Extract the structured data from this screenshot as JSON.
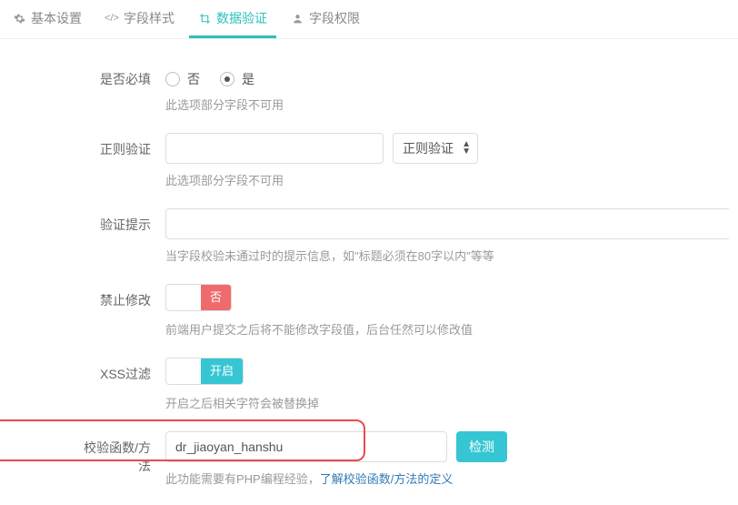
{
  "tabs": {
    "basic": "基本设置",
    "style": "字段样式",
    "validate": "数据验证",
    "perm": "字段权限"
  },
  "required": {
    "label": "是否必填",
    "option_no": "否",
    "option_yes": "是",
    "hint": "此选项部分字段不可用"
  },
  "regex": {
    "label": "正则验证",
    "value": "",
    "select_label": "正则验证",
    "hint": "此选项部分字段不可用"
  },
  "tip": {
    "label": "验证提示",
    "value": "",
    "hint": "当字段校验未通过时的提示信息，如\"标题必须在80字以内\"等等"
  },
  "readonly": {
    "label": "禁止修改",
    "tag": "否",
    "hint": "前端用户提交之后将不能修改字段值，后台任然可以修改值"
  },
  "xss": {
    "label": "XSS过滤",
    "tag": "开启",
    "hint": "开启之后相关字符会被替换掉"
  },
  "func": {
    "label": "校验函数/方法",
    "value": "dr_jiaoyan_hanshu",
    "btn": "检测",
    "hint_a": "此功能需要有PHP编程经验，",
    "hint_b": "了解校验函数/方法的定义"
  }
}
